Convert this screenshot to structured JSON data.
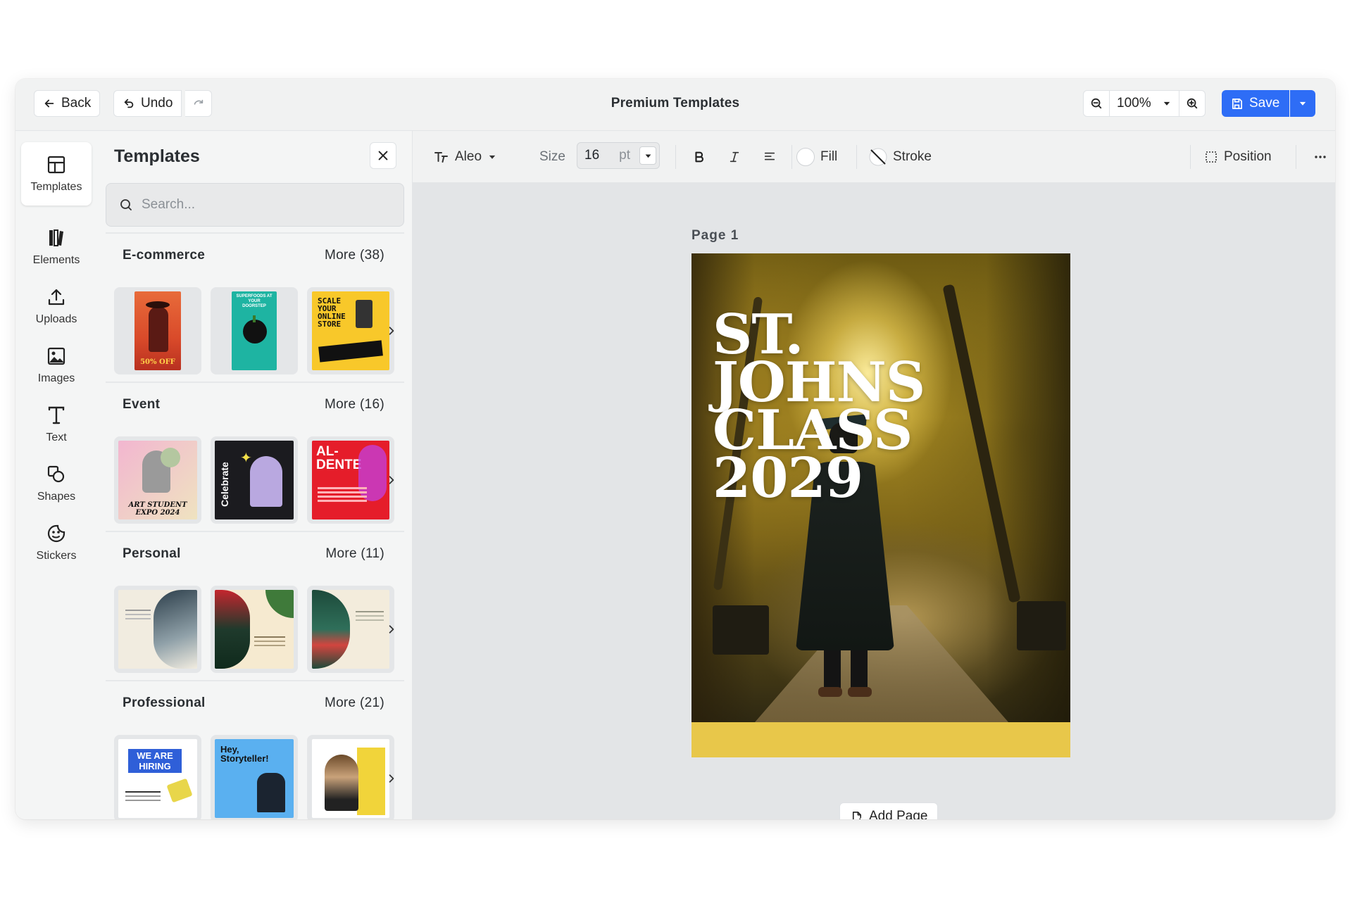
{
  "header": {
    "back_label": "Back",
    "undo_label": "Undo",
    "title": "Premium Templates",
    "zoom": "100%",
    "save_label": "Save"
  },
  "rail": {
    "items": [
      {
        "label": "Templates",
        "icon": "templates-icon",
        "active": true
      },
      {
        "label": "Elements",
        "icon": "elements-icon"
      },
      {
        "label": "Uploads",
        "icon": "upload-icon"
      },
      {
        "label": "Images",
        "icon": "image-icon"
      },
      {
        "label": "Text",
        "icon": "text-icon"
      },
      {
        "label": "Shapes",
        "icon": "shapes-icon"
      },
      {
        "label": "Stickers",
        "icon": "sticker-icon"
      }
    ]
  },
  "panel": {
    "title": "Templates",
    "search_placeholder": "Search...",
    "sections": [
      {
        "name": "E-commerce",
        "more": "More (38)",
        "thumb_texts": [
          "50% OFF",
          "SUPERFOODS AT YOUR DOORSTEP",
          "SCALE YOUR ONLINE STORE"
        ]
      },
      {
        "name": "Event",
        "more": "More (16)",
        "thumb_texts": [
          "ART STUDENT EXPO 2024",
          "Celebrate",
          "AL- DENTE"
        ]
      },
      {
        "name": "Personal",
        "more": "More (11)",
        "thumb_texts": [
          "",
          "",
          ""
        ]
      },
      {
        "name": "Professional",
        "more": "More (21)",
        "thumb_texts": [
          "WE ARE HIRING",
          "Hey, Storyteller!",
          ""
        ]
      }
    ]
  },
  "toolbar": {
    "font": "Aleo",
    "size_label": "Size",
    "size_value": "16",
    "size_unit": "pt",
    "fill_label": "Fill",
    "stroke_label": "Stroke",
    "position_label": "Position"
  },
  "canvas": {
    "page_label": "Page  1",
    "headline": [
      "ST.",
      "JOHNS",
      "CLASS",
      "2029"
    ],
    "add_page_label": "Add Page"
  },
  "colors": {
    "accent": "#2e6df6",
    "page_band": "#e8c74a"
  }
}
